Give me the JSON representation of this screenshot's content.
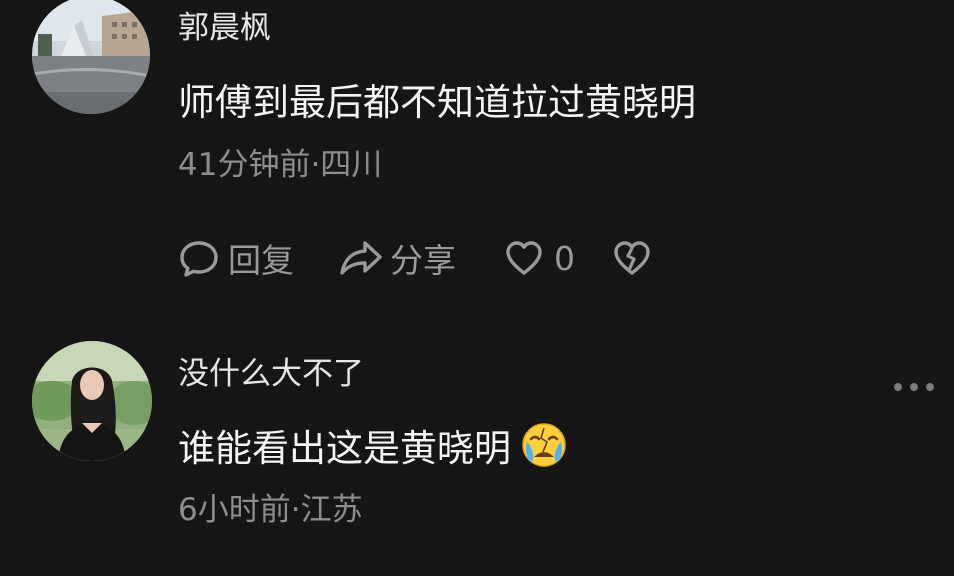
{
  "comments": [
    {
      "username": "郭晨枫",
      "text": "师傅到最后都不知道拉过黄晓明",
      "meta": "41分钟前·四川",
      "actions": {
        "reply_label": "回复",
        "share_label": "分享",
        "like_count": "0"
      },
      "avatar_icon": "building-photo-avatar"
    },
    {
      "username": "没什么大不了",
      "text": "谁能看出这是黄晓明",
      "emoji": "crying-emoji",
      "meta": "6小时前·江苏",
      "avatar_icon": "person-photo-avatar"
    }
  ],
  "colors": {
    "background": "#161616",
    "text_primary": "#f5f5f5",
    "text_secondary": "#8e8e8e",
    "icon": "#9a9a9a"
  }
}
